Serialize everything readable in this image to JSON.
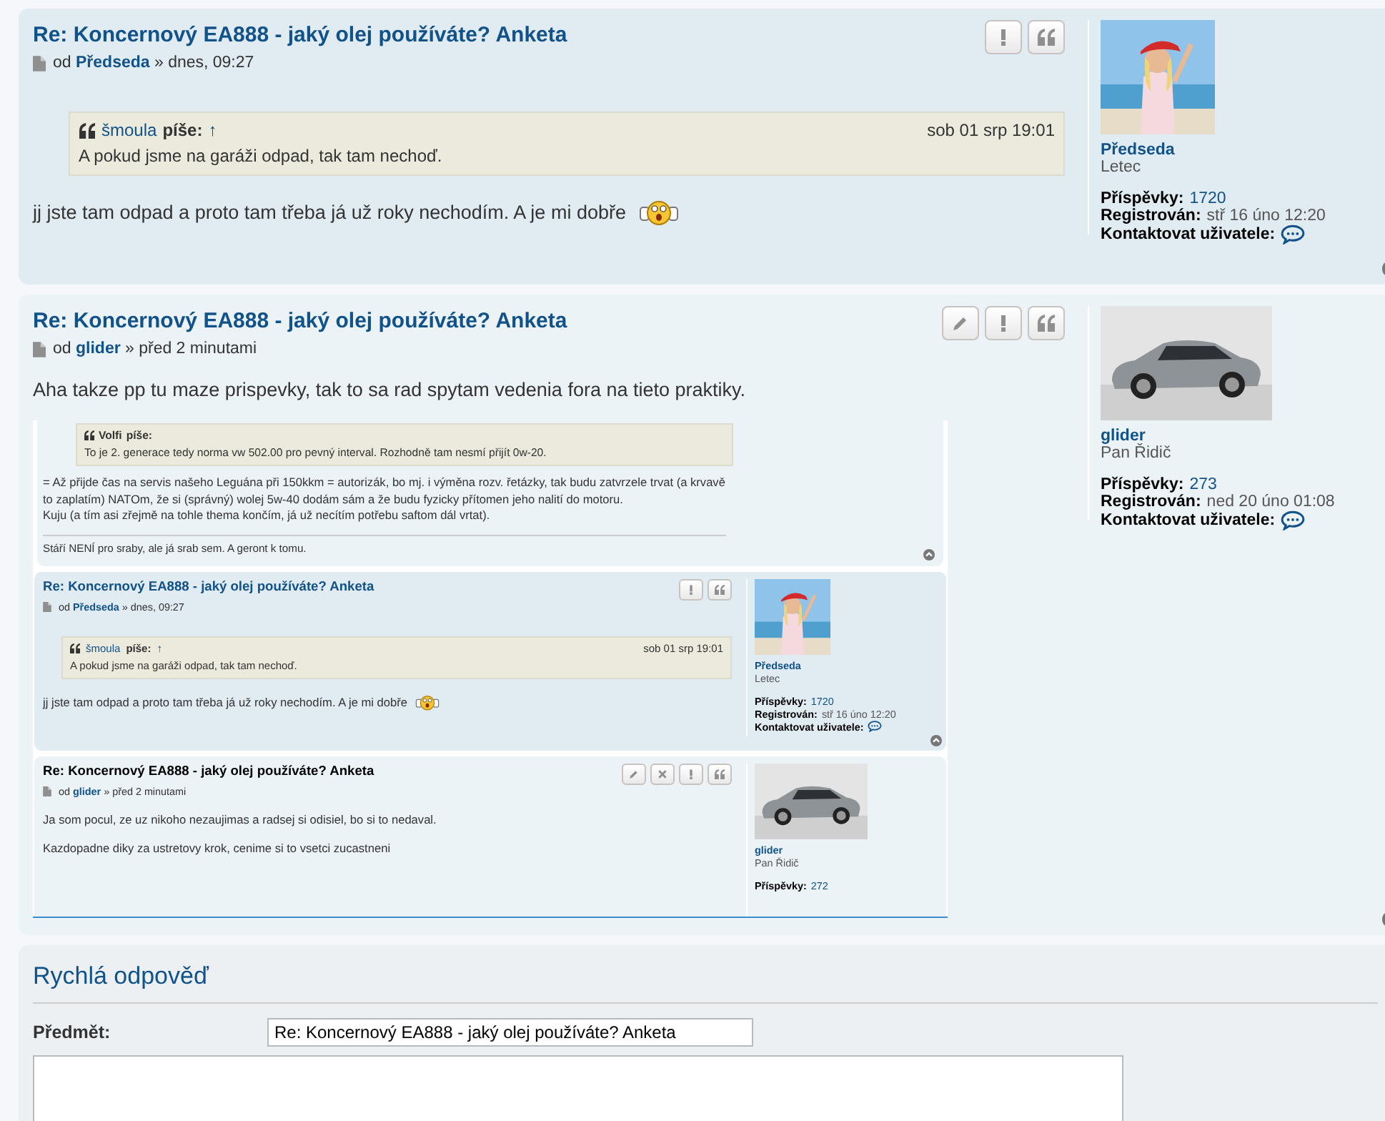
{
  "posts": [
    {
      "title": "Re: Koncernový EA888 - jaký olej používáte? Anketa",
      "by": "od",
      "author": "Předseda",
      "time": "» dnes, 09:27",
      "buttons": [
        {
          "kind": "report"
        },
        {
          "kind": "quote"
        }
      ],
      "quote": {
        "author": "šmoula",
        "says": "píše:",
        "link": "↑",
        "date": "sob 01 srp 19:01",
        "text": "A pokud jsme na garáži odpad, tak tam nechoď."
      },
      "paragraphs": [
        "jj jste tam odpad a proto tam třeba já už roky nechodím. A je mi dobře"
      ],
      "smiley": true,
      "profile": {
        "name": "Předseda",
        "rank": "Letec",
        "stats": [
          {
            "label": "Příspěvky:",
            "value": "1720"
          },
          {
            "label": "Registrován:",
            "value": "stř 16 úno 12:20"
          }
        ],
        "contact": "Kontaktovat uživatele:"
      }
    },
    {
      "title": "Re: Koncernový EA888 - jaký olej používáte? Anketa",
      "by": "od",
      "author": "glider",
      "time": "» před 2 minutami",
      "buttons": [
        {
          "kind": "edit"
        },
        {
          "kind": "report"
        },
        {
          "kind": "quote"
        }
      ],
      "paragraphs": [
        "Aha takze pp tu maze prispevky, tak to sa rad spytam vedenia fora na tieto praktiky."
      ],
      "embed": {
        "quote": {
          "author": "Volfi",
          "says": "píše:",
          "text": "To je 2. generace tedy norma vw 502.00 pro pevný interval. Rozhodně tam nesmí přijít 0w-20."
        },
        "paragraphs": [
          "= Až přijde čas na servis našeho Leguána při 150kkm = autorizák, bo mj. i výměna rozv. řetázky, tak budu zatvrzele trvat (a krvavě to zaplatím) NATOm, že si (správný) wolej 5w-40 dodám sám a že budu fyzicky přítomen jeho nalití do motoru.",
          "Kuju (a tím asi zřejmě na tohle thema končím, já už necítím potřebu saftom dál vrtat)."
        ],
        "signature": "Stáří NENÍ pro sraby, ale já srab sem. A geront k tomu.",
        "posts": [
          {
            "title": "Re: Koncernový EA888 - jaký olej používáte? Anketa",
            "by": "od",
            "author": "Předseda",
            "time": "» dnes, 09:27",
            "buttons": [
              {
                "kind": "report"
              },
              {
                "kind": "quote"
              }
            ],
            "quote": {
              "author": "šmoula",
              "says": "píše:",
              "link": "↑",
              "date": "sob 01 srp 19:01",
              "text": "A pokud jsme na garáži odpad, tak tam nechoď."
            },
            "paragraphs": [
              "jj jste tam odpad a proto tam třeba já už roky nechodím. A je mi dobře"
            ],
            "smiley": true,
            "profile": {
              "name": "Předseda",
              "rank": "Letec",
              "stats": [
                {
                  "label": "Příspěvky:",
                  "value": "1720"
                },
                {
                  "label": "Registrován:",
                  "value": "stř 16 úno 12:20"
                }
              ],
              "contact": "Kontaktovat uživatele:"
            }
          },
          {
            "title": "Re: Koncernový EA888 - jaký olej používáte? Anketa",
            "by": "od",
            "author": "glider",
            "time": "» před 2 minutami",
            "buttons": [
              {
                "kind": "edit"
              },
              {
                "kind": "delete"
              },
              {
                "kind": "report"
              },
              {
                "kind": "quote"
              }
            ],
            "paragraphs": [
              "Ja som pocul, ze uz nikoho nezaujimas a radsej si odisiel, bo si to nedaval.",
              "Kazdopadne diky za ustretovy krok, cenime si to vsetci zucastneni"
            ],
            "profile": {
              "name": "glider",
              "rank": "Pan Řidič",
              "stats": [
                {
                  "label": "Příspěvky:",
                  "value": "272"
                }
              ]
            }
          }
        ]
      },
      "profile": {
        "name": "glider",
        "rank": "Pan Řidič",
        "stats": [
          {
            "label": "Příspěvky:",
            "value": "273"
          },
          {
            "label": "Registrován:",
            "value": "ned 20 úno 01:08"
          }
        ],
        "contact": "Kontaktovat uživatele:"
      }
    }
  ],
  "reply": {
    "heading": "Rychlá odpověď",
    "subject_label": "Předmět:",
    "subject": "Re: Koncernový EA888 - jaký olej používáte? Anketa"
  }
}
